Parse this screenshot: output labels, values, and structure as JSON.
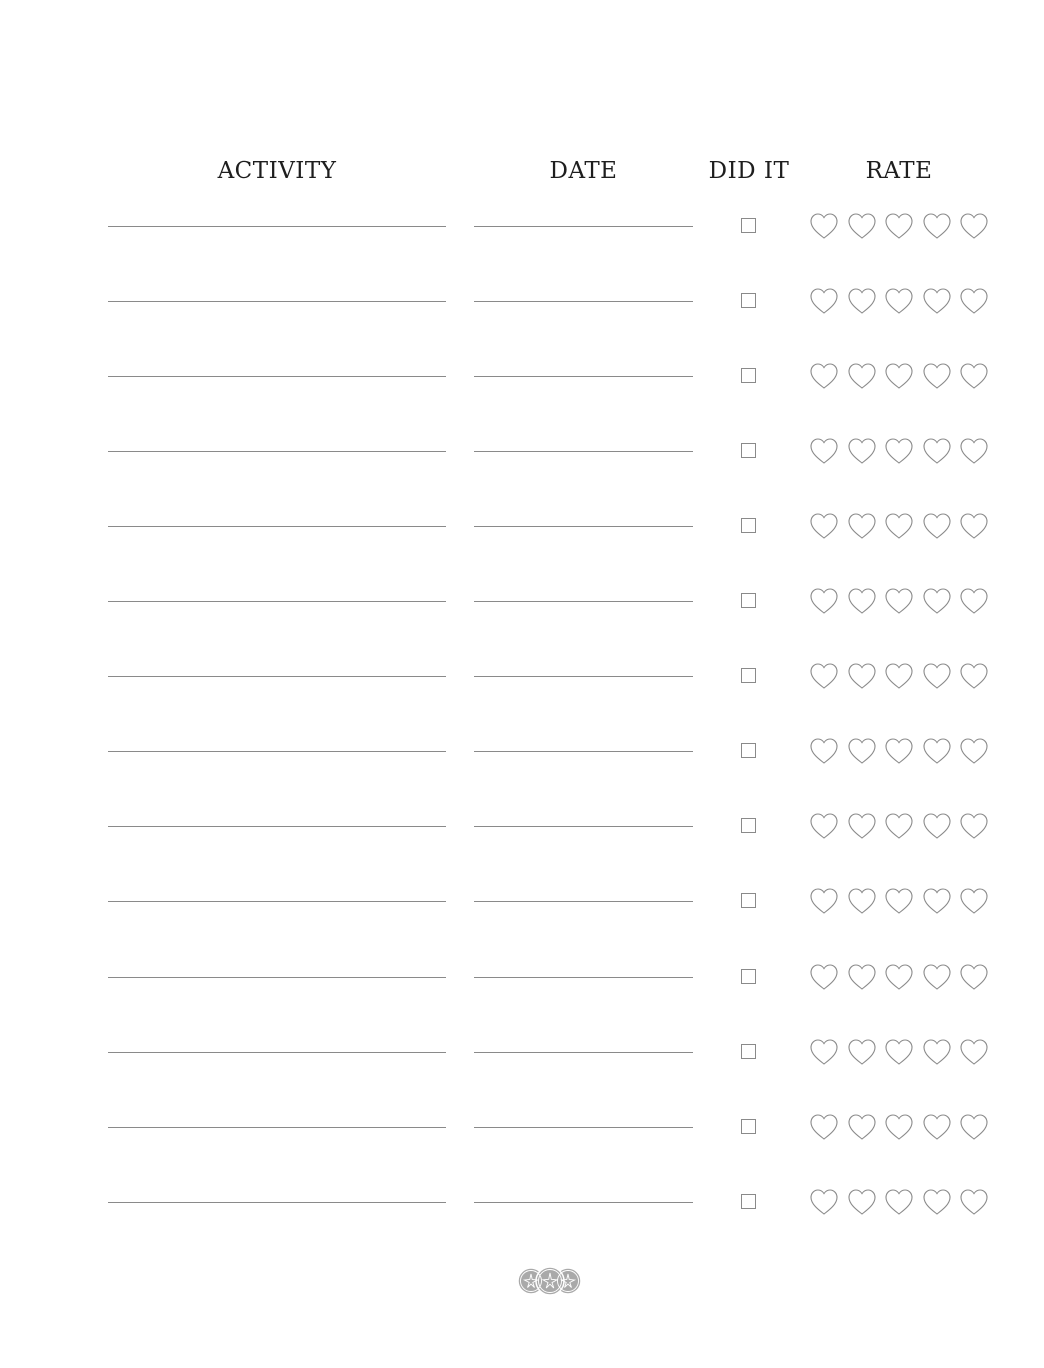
{
  "headers": {
    "activity": "ACTIVITY",
    "date": "DATE",
    "did_it": "DID IT",
    "rate": "RATE"
  },
  "row_count": 14,
  "hearts_per_row": 5,
  "colors": {
    "line": "#8a8a8a",
    "heart_stroke": "#8a8a8a",
    "logo": "#a9a9a9"
  },
  "icons": {
    "rating": "heart-outline-icon",
    "check": "checkbox-icon",
    "footer": "starfish-circles-logo"
  }
}
